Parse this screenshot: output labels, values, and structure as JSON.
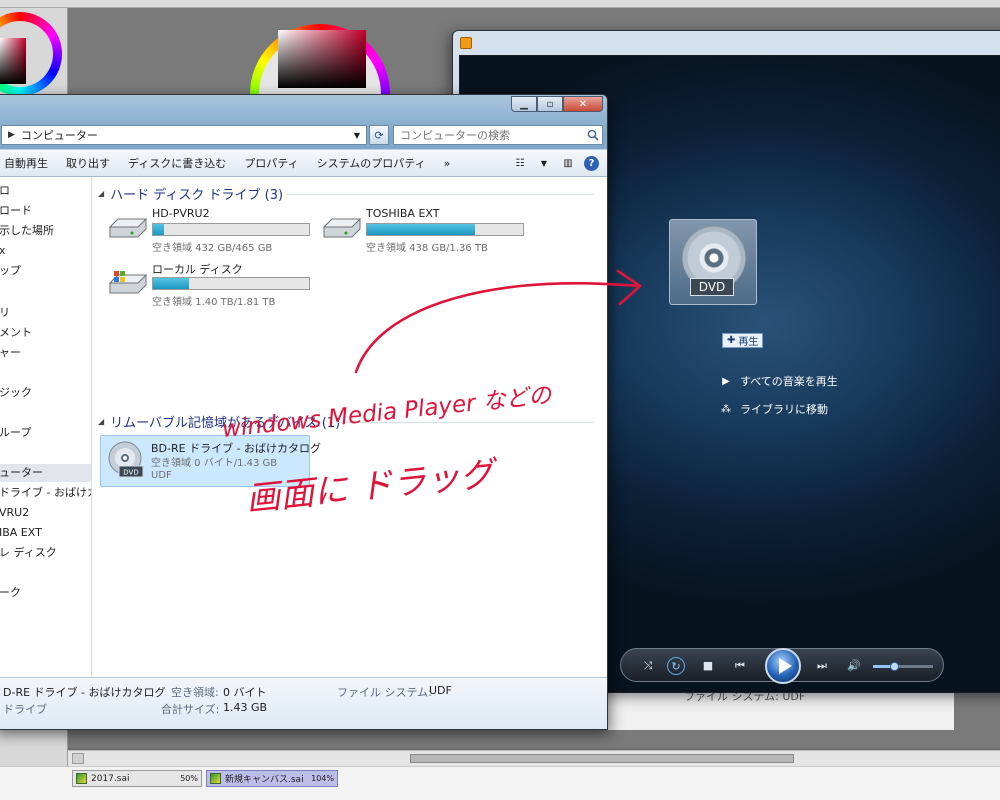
{
  "explorer": {
    "address": "コンピューター",
    "search_placeholder": "コンピューターの検索",
    "commands": [
      "自動再生",
      "取り出す",
      "ディスクに書き込む",
      "プロパティ",
      "システムのプロパティ",
      "»"
    ],
    "nav_items": [
      "ロ",
      "ロード",
      "示した場所",
      "x",
      "ップ",
      "リ",
      "メント",
      "ャー",
      "ジック",
      "ループ",
      "ューター",
      "ドライブ - おばけカ",
      "VRU2",
      "IBA EXT",
      "レ ディスク",
      "ーク"
    ],
    "nav_selected_index": 10,
    "groups": {
      "hard_disks": "ハード ディスク ドライブ (3)",
      "removable": "リムーバブル記憶域があるデバイス (1)"
    },
    "drives": [
      {
        "name": "HD-PVRU2",
        "free": "空き領域 432 GB/465 GB",
        "used_fraction": 0.07
      },
      {
        "name": "TOSHIBA EXT",
        "free": "空き領域 438 GB/1.36 TB",
        "used_fraction": 0.69
      },
      {
        "name": "ローカル ディスク",
        "free": "空き領域 1.40 TB/1.81 TB",
        "used_fraction": 0.23
      }
    ],
    "removable_drive": {
      "name": "BD-RE ドライブ - おばけカタログ",
      "free": "空き領域 0 バイト/1.43 GB",
      "fs": "UDF",
      "icon_label": "DVD"
    },
    "details": {
      "name": "D-RE ドライブ - おばけカタログ",
      "type": "ドライブ",
      "free_label": "空き領域:",
      "free_value": "0 バイト",
      "total_label": "合計サイズ:",
      "total_value": "1.43 GB",
      "fs_label": "ファイル システム:",
      "fs_value": "UDF"
    }
  },
  "wmp": {
    "dvd_label": "DVD",
    "play_chip": "再生",
    "links": [
      "すべての音楽を再生",
      "ライブラリに移動"
    ],
    "volume_fraction": 0.35,
    "behind_text": "ファイル システム: UDF"
  },
  "annotation": {
    "line1": "windows Media Player などの",
    "line2": "画面に ドラッグ"
  },
  "sai": {
    "tabs": [
      {
        "name": "2017.sai",
        "zoom": "50%"
      },
      {
        "name": "新規キャンバス.sai",
        "zoom": "104%"
      }
    ]
  },
  "colors": {
    "accent_blue": "#1e3287",
    "annotation_red": "#e0143a",
    "bar_fill": "#1c97c0",
    "wmp_bg": "#0b1f35"
  }
}
